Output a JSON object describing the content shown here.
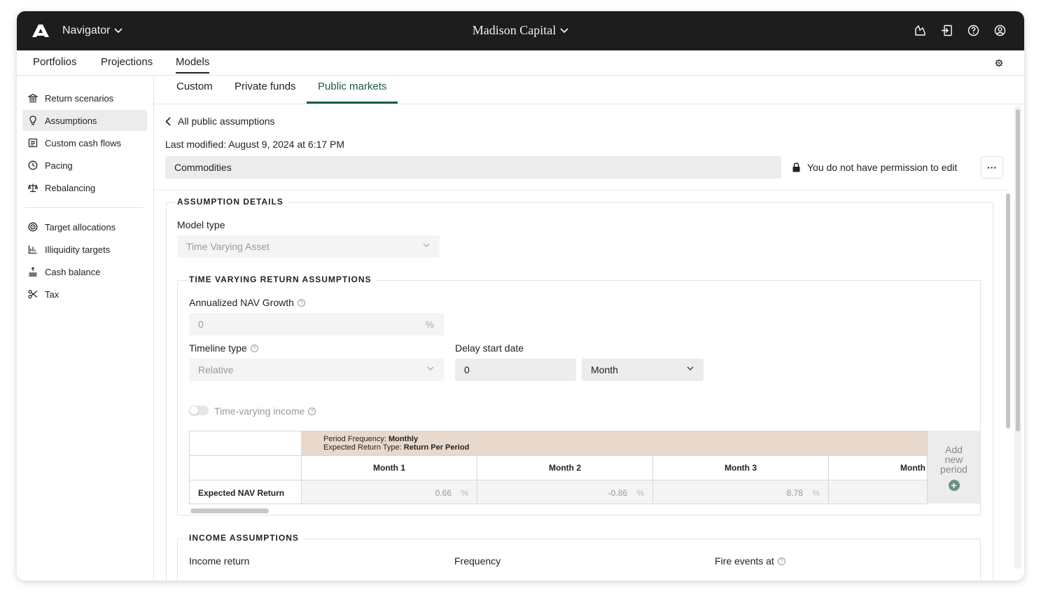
{
  "topbar": {
    "app_name": "Navigator",
    "org_name": "Madison Capital"
  },
  "mainnav": {
    "items": [
      "Portfolios",
      "Projections",
      "Models"
    ]
  },
  "sidebar": {
    "group1": [
      "Return scenarios",
      "Assumptions",
      "Custom cash flows",
      "Pacing",
      "Rebalancing"
    ],
    "group2": [
      "Target allocations",
      "Illiquidity targets",
      "Cash balance",
      "Tax"
    ]
  },
  "subtabs": [
    "Custom",
    "Private funds",
    "Public markets"
  ],
  "header": {
    "back_label": "All public assumptions",
    "last_modified": "Last modified: August 9, 2024 at 6:17 PM",
    "name": "Commodities",
    "permission": "You do not have permission to edit",
    "more": "···"
  },
  "details": {
    "legend": "ASSUMPTION DETAILS",
    "model_type_label": "Model type",
    "model_type_value": "Time Varying Asset"
  },
  "tvr": {
    "legend": "TIME VARYING RETURN ASSUMPTIONS",
    "nav_growth_label": "Annualized NAV Growth",
    "nav_growth_value": "0",
    "percent": "%",
    "timeline_label": "Timeline type",
    "timeline_value": "Relative",
    "delay_label": "Delay start date",
    "delay_value": "0",
    "delay_unit": "Month",
    "tv_income_label": "Time-varying income",
    "period_freq_label": "Period Frequency:",
    "period_freq_value": "Monthly",
    "return_type_label": "Expected Return Type:",
    "return_type_value": "Return Per Period",
    "row_label": "Expected NAV Return",
    "columns": [
      "Month 1",
      "Month 2",
      "Month 3",
      "Month"
    ],
    "values": [
      "0.66",
      "-0.86",
      "8.78",
      ""
    ],
    "add_period": "Add new period"
  },
  "income": {
    "legend": "INCOME ASSUMPTIONS",
    "income_return_label": "Income return",
    "frequency_label": "Frequency",
    "fire_events_label": "Fire events at"
  }
}
